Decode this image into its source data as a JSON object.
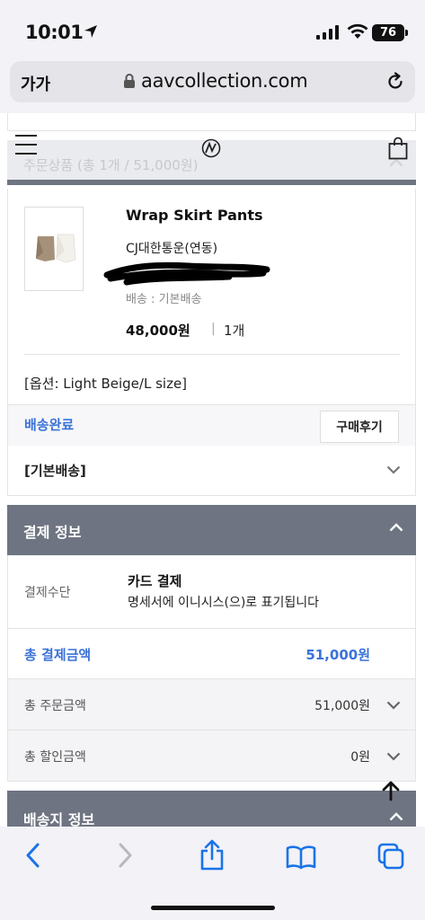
{
  "status_bar": {
    "time": "10:01",
    "battery": "76"
  },
  "address_bar": {
    "text_size_label": "가가",
    "url": "aavcollection.com"
  },
  "order_products": {
    "header": "주문상품 (총 1개 / 51,000원)"
  },
  "product": {
    "name": "Wrap Skirt Pants",
    "courier": "CJ대한통운(연동)",
    "shipping_type": "배송 : 기본배송",
    "price": "48,000원",
    "separator": "|",
    "quantity": "1개",
    "option": "[옵션: Light Beige/L size]",
    "status": "배송완료",
    "review_button": "구매후기"
  },
  "basic_shipping": {
    "label": "[기본배송]"
  },
  "payment_info": {
    "header": "결제 정보",
    "method_label": "결제수단",
    "method_value": "카드 결제",
    "method_note": "명세서에 이니시스(으)로 표기됩니다",
    "total_label": "총 결제금액",
    "total_value": "51,000원",
    "order_total_label": "총 주문금액",
    "order_total_value": "51,000원",
    "discount_label": "총 할인금액",
    "discount_value": "0원"
  },
  "shipping_info": {
    "header": "배송지 정보"
  },
  "colors": {
    "accent_blue": "#3a72d8",
    "section_header": "#6e7481"
  }
}
